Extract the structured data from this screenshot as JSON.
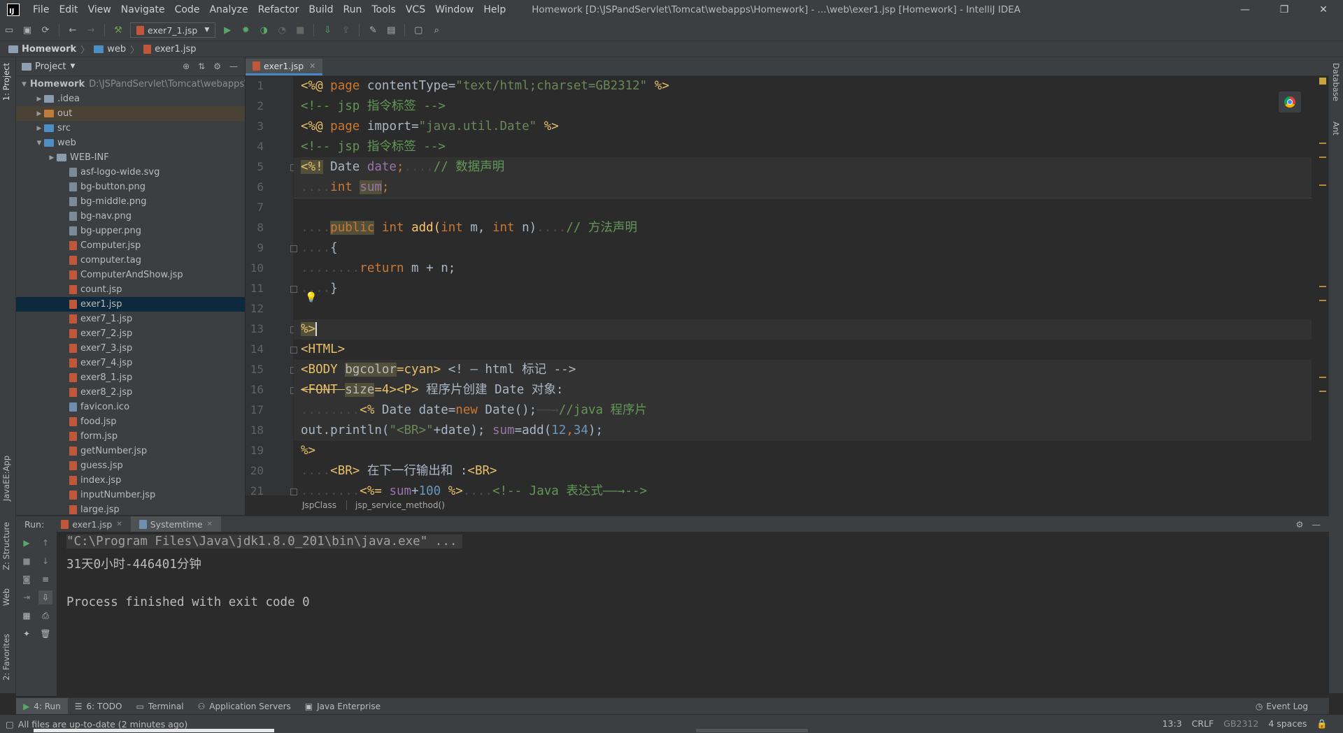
{
  "window": {
    "title": "Homework [D:\\JSPandServlet\\Tomcat\\webapps\\Homework] - ...\\web\\exer1.jsp [Homework] - IntelliJ IDEA",
    "menu": [
      "File",
      "Edit",
      "View",
      "Navigate",
      "Code",
      "Analyze",
      "Refactor",
      "Build",
      "Run",
      "Tools",
      "VCS",
      "Window",
      "Help"
    ]
  },
  "toolbar": {
    "run_config": "exer7_1.jsp"
  },
  "breadcrumb": [
    "Homework",
    "web",
    "exer1.jsp"
  ],
  "left_strip": {
    "project_tab": "1: Project",
    "structure_tab": "Z: Structure",
    "web_tab": "Web",
    "favorites_tab": "2: Favorites",
    "javaee_tab": "JavaEE:App"
  },
  "right_strip": {
    "database_tab": "Database",
    "ant_tab": "Ant"
  },
  "project": {
    "title": "Project",
    "root": {
      "name": "Homework",
      "path": "D:\\JSPandServlet\\Tomcat\\webapps\\Homework"
    },
    "items": [
      {
        "label": ".idea",
        "kind": "folder"
      },
      {
        "label": "out",
        "kind": "folder-orange"
      },
      {
        "label": "src",
        "kind": "folder-blue"
      },
      {
        "label": "web",
        "kind": "folder-blue"
      },
      {
        "label": "WEB-INF",
        "kind": "folder"
      },
      {
        "label": "asf-logo-wide.svg",
        "kind": "img"
      },
      {
        "label": "bg-button.png",
        "kind": "img"
      },
      {
        "label": "bg-middle.png",
        "kind": "img"
      },
      {
        "label": "bg-nav.png",
        "kind": "img"
      },
      {
        "label": "bg-upper.png",
        "kind": "img"
      },
      {
        "label": "Computer.jsp",
        "kind": "jsp"
      },
      {
        "label": "computer.tag",
        "kind": "tag"
      },
      {
        "label": "ComputerAndShow.jsp",
        "kind": "jsp"
      },
      {
        "label": "count.jsp",
        "kind": "jsp"
      },
      {
        "label": "exer1.jsp",
        "kind": "jsp"
      },
      {
        "label": "exer7_1.jsp",
        "kind": "jsp"
      },
      {
        "label": "exer7_2.jsp",
        "kind": "jsp"
      },
      {
        "label": "exer7_3.jsp",
        "kind": "jsp"
      },
      {
        "label": "exer7_4.jsp",
        "kind": "jsp"
      },
      {
        "label": "exer8_1.jsp",
        "kind": "jsp"
      },
      {
        "label": "exer8_2.jsp",
        "kind": "jsp"
      },
      {
        "label": "favicon.ico",
        "kind": "ico"
      },
      {
        "label": "food.jsp",
        "kind": "jsp"
      },
      {
        "label": "form.jsp",
        "kind": "jsp"
      },
      {
        "label": "getNumber.jsp",
        "kind": "jsp"
      },
      {
        "label": "guess.jsp",
        "kind": "jsp"
      },
      {
        "label": "index.jsp",
        "kind": "jsp"
      },
      {
        "label": "inputNumber.jsp",
        "kind": "jsp"
      },
      {
        "label": "large.jsp",
        "kind": "jsp"
      }
    ]
  },
  "editor": {
    "tab": "exer1.jsp",
    "line_numbers": [
      "1",
      "2",
      "3",
      "4",
      "5",
      "6",
      "7",
      "8",
      "9",
      "10",
      "11",
      "12",
      "13",
      "14",
      "15",
      "16",
      "17",
      "18",
      "19",
      "20",
      "21"
    ],
    "crumbs": [
      "JspClass",
      "jsp_service_method()"
    ],
    "code": {
      "l1_a": "<%@ ",
      "l1_b": "page",
      "l1_c": " contentType=",
      "l1_d": "\"text/html;charset=GB2312\"",
      "l1_e": " %>",
      "l2": "<!-- jsp 指令标签 -->",
      "l3_a": "<%@ ",
      "l3_b": "page",
      "l3_c": " import=",
      "l3_d": "\"java.util.Date\"",
      "l3_e": " %>",
      "l4": "<!-- jsp 指令标签 -->",
      "l5_a": "<%!",
      "l5_b": " Date ",
      "l5_c": "date",
      "l5_d": ";",
      "l5_e": "....",
      "l5_f": "// 数据声明",
      "l6_a": "....",
      "l6_b": "int ",
      "l6_c": "sum",
      "l6_d": ";",
      "l8_a": "....",
      "l8_b": "public",
      "l8_c": " int",
      "l8_d": " add(",
      "l8_e": "int",
      "l8_f": " m, ",
      "l8_g": "int",
      "l8_h": " n)",
      "l8_i": "....",
      "l8_j": "// 方法声明",
      "l9_a": "....",
      "l9_b": "{",
      "l10_a": "........",
      "l10_b": "return",
      "l10_c": " m + n;",
      "l11_a": "....",
      "l11_b": "}",
      "l13": "%>",
      "l14": "<HTML>",
      "l15_a": "<BODY ",
      "l15_b": "bgcolor",
      "l15_c": "=cyan>",
      "l15_d": " <! — html 标记 -->",
      "l16_a": "<FONT ",
      "l16_b": "size",
      "l16_c": "=4><P>",
      "l16_d": " 程序片创建 Date 对象:",
      "l17_a": "........",
      "l17_b": "<%",
      "l17_c": " Date date=",
      "l17_d": "new",
      "l17_e": " Date();",
      "l17_f": "——→",
      "l17_g": "//java 程序片",
      "l18_a": "out.println(",
      "l18_b": "\"<BR>\"",
      "l18_c": "+date); ",
      "l18_d": "sum",
      "l18_e": "=add(",
      "l18_f": "12",
      "l18_g": ",",
      "l18_h": "34",
      "l18_i": ");",
      "l19": "%>",
      "l20_a": "....",
      "l20_b": "<BR>",
      "l20_c": " 在下一行输出和 :",
      "l20_d": "<BR>",
      "l21_a": "........",
      "l21_b": "<%=",
      "l21_c": " sum",
      "l21_d": "+",
      "l21_e": "100",
      "l21_f": " %>",
      "l21_g": "....",
      "l21_h": "<!-- Java 表达式——→-->"
    }
  },
  "run": {
    "label": "Run:",
    "tabs": [
      "exer1.jsp",
      "Systemtime"
    ],
    "console": [
      "\"C:\\Program Files\\Java\\jdk1.8.0_201\\bin\\java.exe\" ...",
      "31天0小时-446401分钟",
      "",
      "Process finished with exit code 0"
    ]
  },
  "bottom_tools": [
    "4: Run",
    "6: TODO",
    "Terminal",
    "Application Servers",
    "Java Enterprise"
  ],
  "event_log": "Event Log",
  "status": {
    "message": "All files are up-to-date (2 minutes ago)",
    "position": "13:3",
    "line_sep": "CRLF",
    "encoding": "GB2312",
    "indent": "4 spaces"
  },
  "colors": {
    "accent": "#4a88c7",
    "background": "#2b2b2b",
    "panel": "#3c3f41",
    "keyword": "#cc7832",
    "string": "#6a8759",
    "comment": "#629755"
  }
}
